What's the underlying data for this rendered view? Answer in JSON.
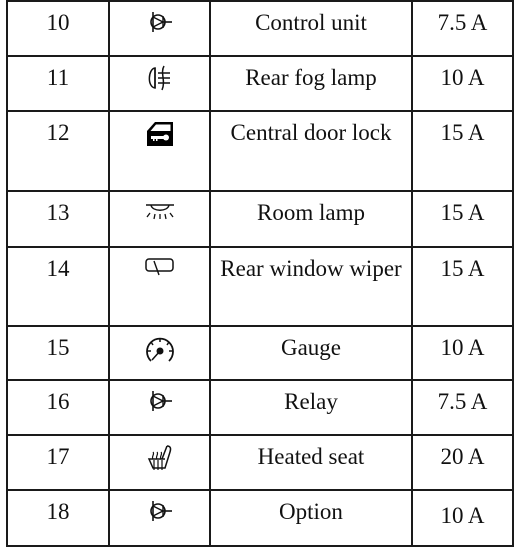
{
  "fuse_table": {
    "rows": [
      {
        "number": "10",
        "icon": "transistor-icon",
        "description": "Control unit",
        "rating": "7.5 A"
      },
      {
        "number": "11",
        "icon": "rear-fog-lamp-icon",
        "description": "Rear fog lamp",
        "rating": "10 A"
      },
      {
        "number": "12",
        "icon": "door-lock-icon",
        "description": "Central door lock",
        "rating": "15 A"
      },
      {
        "number": "13",
        "icon": "room-lamp-icon",
        "description": "Room lamp",
        "rating": "15 A"
      },
      {
        "number": "14",
        "icon": "rear-wiper-icon",
        "description": "Rear window wiper",
        "rating": "15 A"
      },
      {
        "number": "15",
        "icon": "gauge-icon",
        "description": "Gauge",
        "rating": "10 A"
      },
      {
        "number": "16",
        "icon": "transistor-icon",
        "description": "Relay",
        "rating": "7.5 A"
      },
      {
        "number": "17",
        "icon": "heated-seat-icon",
        "description": "Heated seat",
        "rating": "20 A"
      },
      {
        "number": "18",
        "icon": "transistor-icon",
        "description": "Option",
        "rating": "10 A"
      }
    ]
  }
}
